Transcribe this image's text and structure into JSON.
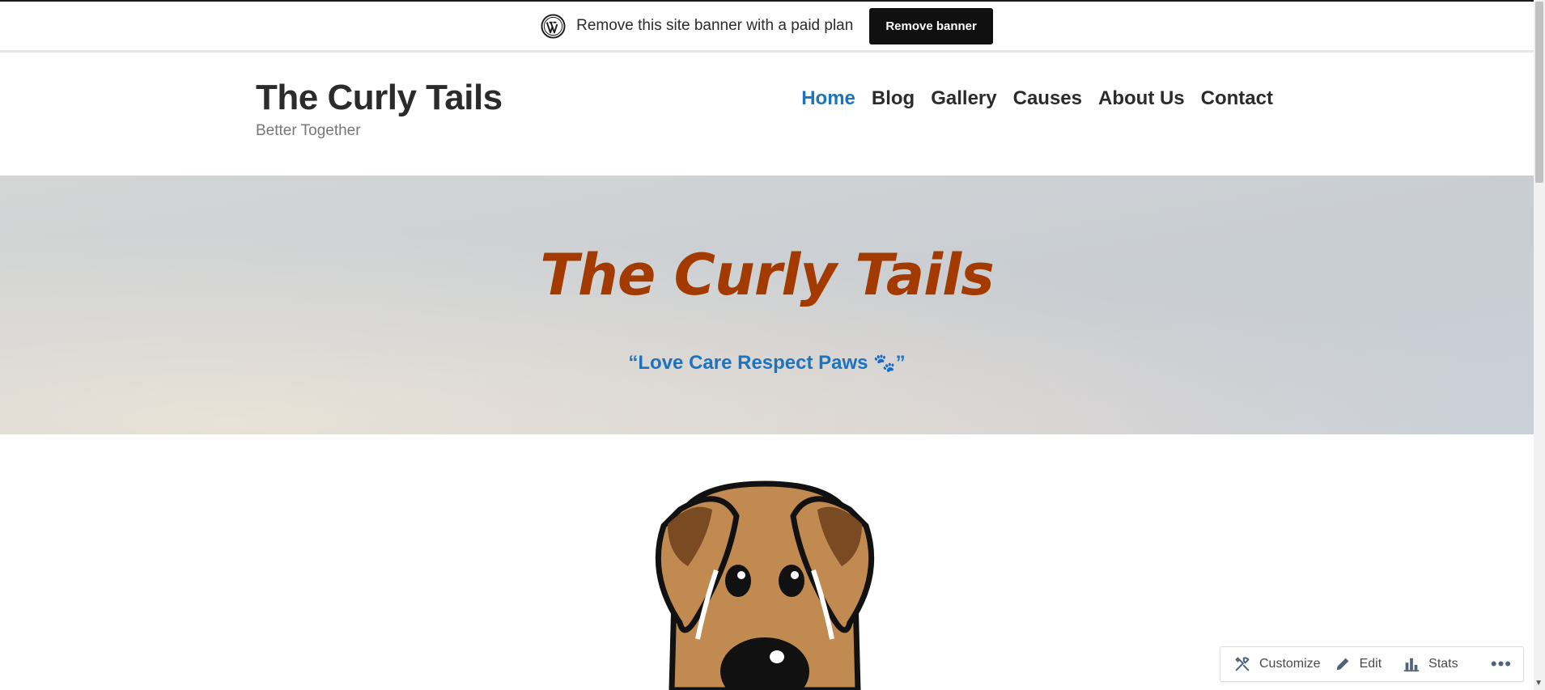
{
  "banner": {
    "message": "Remove this site banner with a paid plan",
    "button_label": "Remove banner"
  },
  "header": {
    "site_title": "The Curly Tails",
    "tagline": "Better Together",
    "nav": [
      {
        "label": "Home",
        "active": true
      },
      {
        "label": "Blog"
      },
      {
        "label": "Gallery"
      },
      {
        "label": "Causes"
      },
      {
        "label": "About Us"
      },
      {
        "label": "Contact"
      }
    ]
  },
  "hero": {
    "title": "The Curly Tails",
    "quote_open": "“",
    "quote_text": "Love Care Respect Paws ",
    "quote_icon": "🐾",
    "quote_close": "”"
  },
  "admin_bar": {
    "items": [
      {
        "label": "Customize",
        "icon": "tools-icon"
      },
      {
        "label": "Edit",
        "icon": "pencil-icon"
      },
      {
        "label": "Stats",
        "icon": "bar-chart-icon"
      }
    ],
    "more_label": "•••"
  },
  "colors": {
    "accent": "#1e73be",
    "hero_title": "#a33b00",
    "banner_button": "#101010"
  }
}
